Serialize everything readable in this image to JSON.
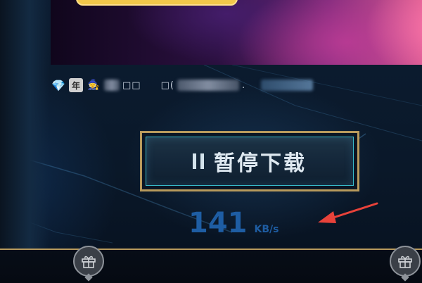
{
  "banner": {
    "accent": "#f2c84a"
  },
  "user_row": {
    "badges": [
      {
        "icon": "diamond-icon",
        "glyph": "💎"
      },
      {
        "icon": "year-badge",
        "text": "年"
      },
      {
        "icon": "wizard-hat-icon",
        "glyph": "🧙"
      }
    ],
    "name_fragment": "□□",
    "account_prefix": "□(",
    "account_suffix": "."
  },
  "download": {
    "pause_label": "暂停下载",
    "speed_value": "141",
    "speed_unit": "KB/s",
    "button_border_color": "#b89a5c",
    "button_inner_border_color": "#37b9c8",
    "speed_color": "#1e5da3"
  },
  "annotation": {
    "arrow_color": "#e8423a"
  },
  "bottom_bar": {
    "border_color": "#b89a5c",
    "gift_buttons": [
      {
        "icon": "gift-icon"
      },
      {
        "icon": "gift-icon"
      }
    ]
  }
}
